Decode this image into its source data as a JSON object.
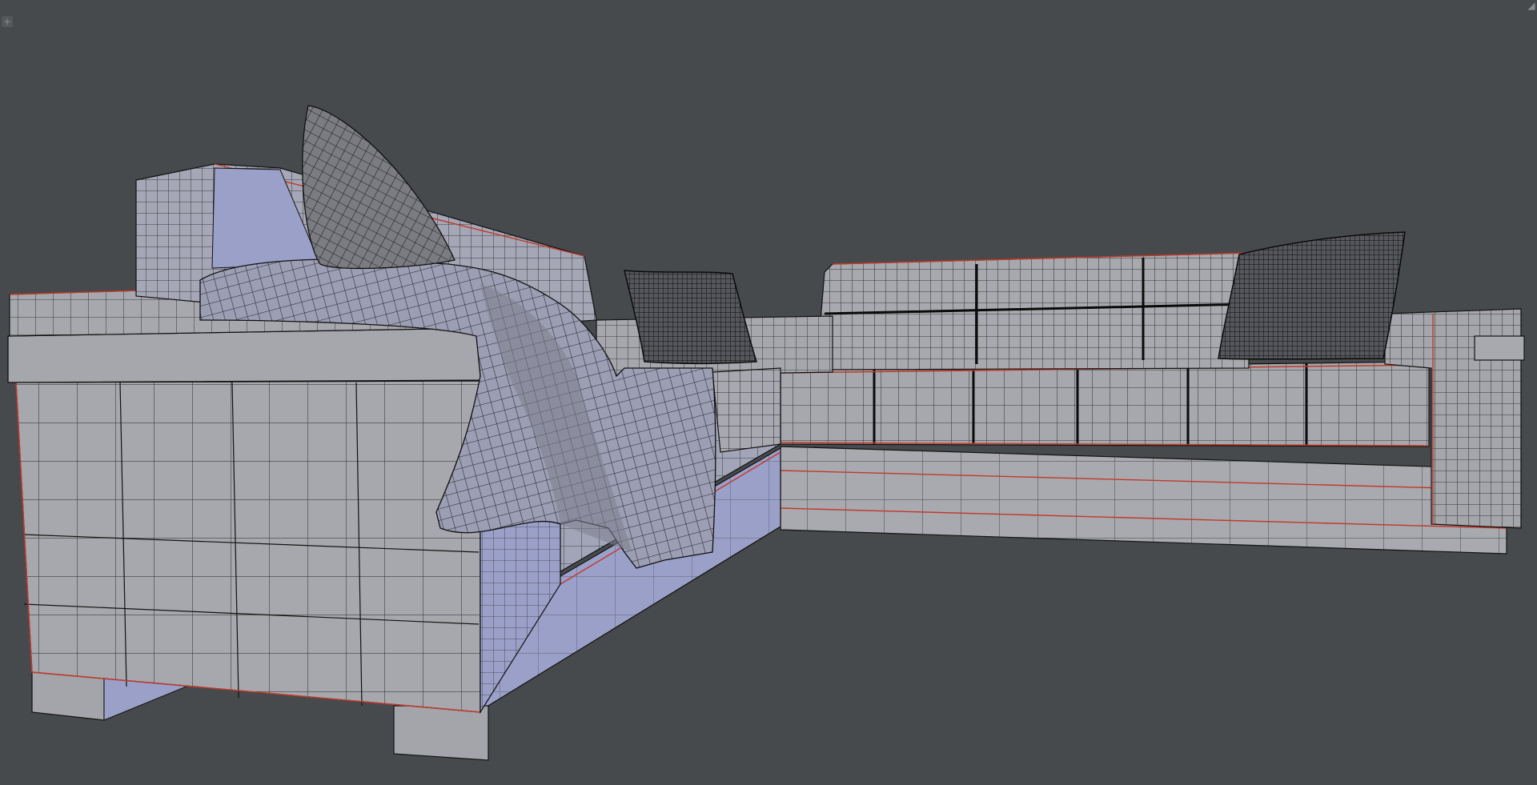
{
  "viewport": {
    "background": "#474a4d",
    "mode": "wireframe-overlay"
  },
  "colors": {
    "face_light": "#a7a8ad",
    "face_mid": "#9a9ba1",
    "face_blue": "#9aa0c6",
    "face_dark": "#7e7f86",
    "pillow_dark": "#4f5155",
    "wire": "#111111",
    "seam": "#c0392b"
  },
  "icons": {
    "corner_top_left": "plus-icon",
    "corner_top_right": "corner-drag-icon"
  },
  "glyphs": {
    "plus": "+",
    "corner": "◢"
  }
}
